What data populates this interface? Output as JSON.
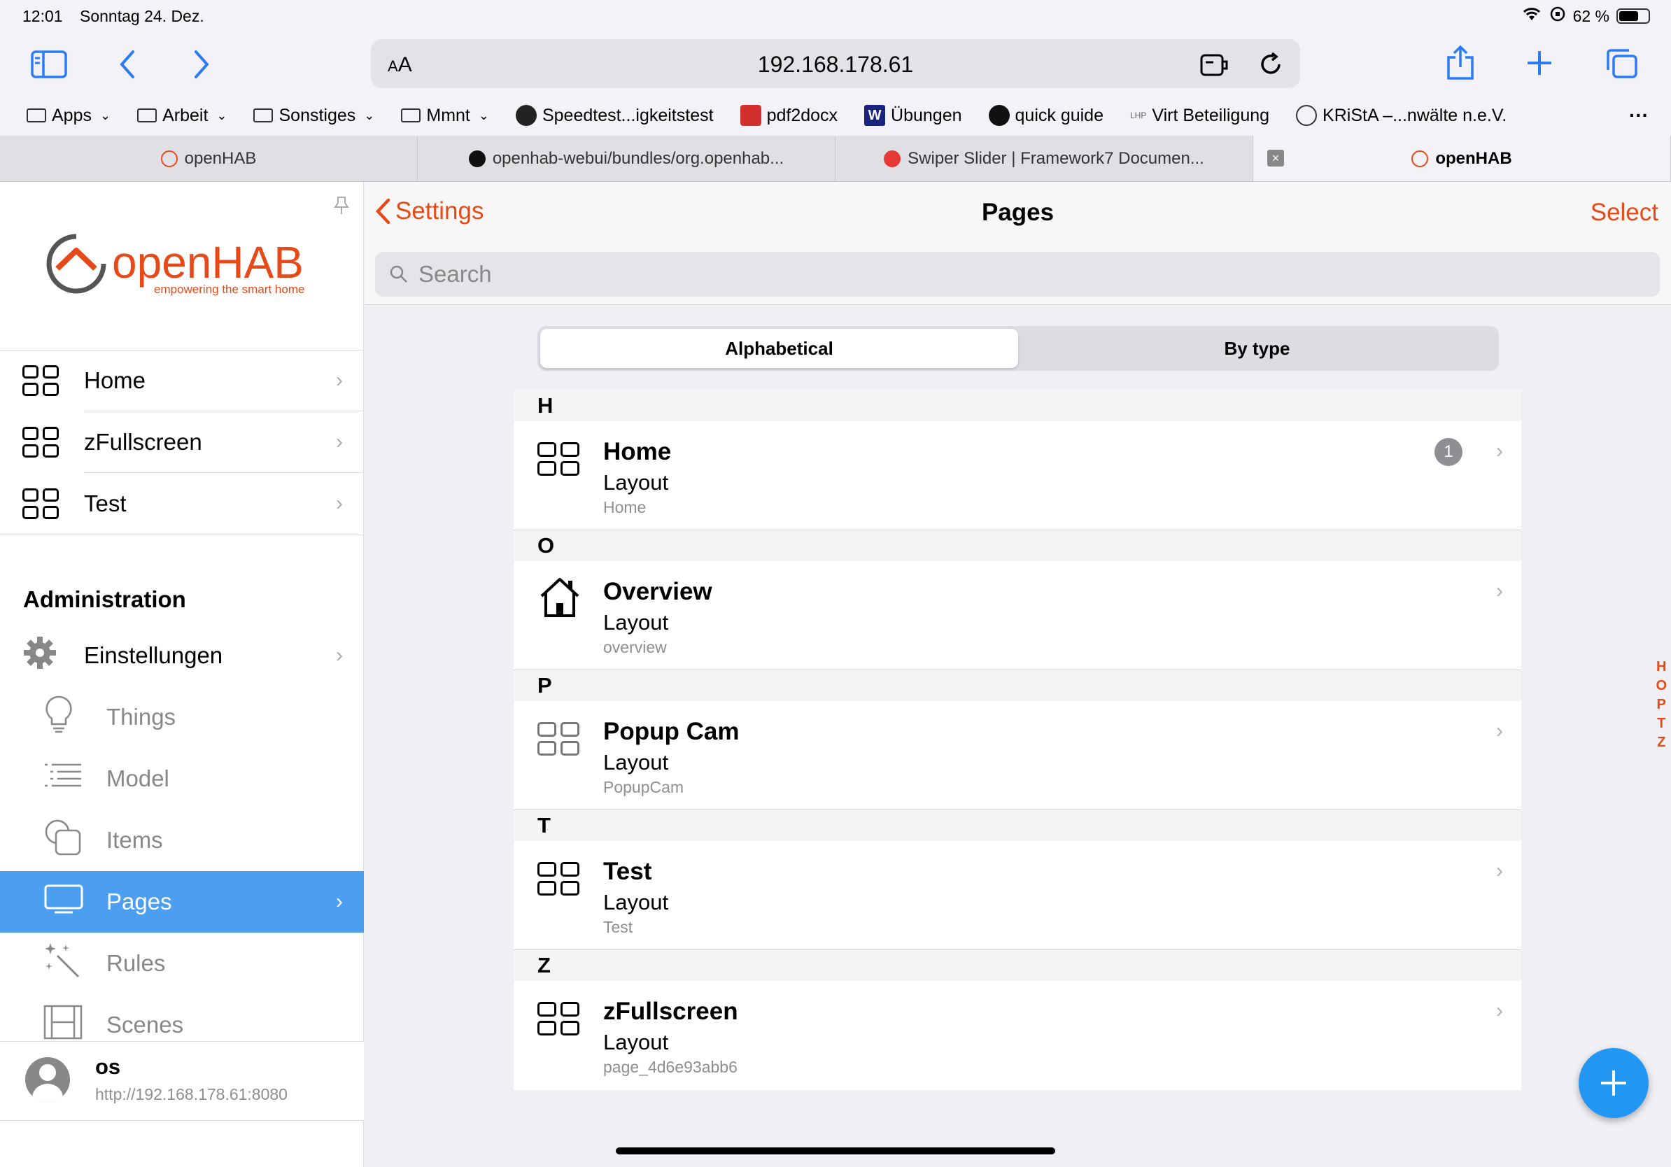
{
  "status": {
    "time": "12:01",
    "date": "Sonntag 24. Dez.",
    "battery": "62 %"
  },
  "browser": {
    "url": "192.168.178.61",
    "aa": "AA",
    "bookmarks": [
      {
        "label": "Apps",
        "folder": true
      },
      {
        "label": "Arbeit",
        "folder": true
      },
      {
        "label": "Sonstiges",
        "folder": true
      },
      {
        "label": "Mmnt",
        "folder": true
      },
      {
        "label": "Speedtest...igkeitstest",
        "folder": false
      },
      {
        "label": "pdf2docx",
        "folder": false
      },
      {
        "label": "Übungen",
        "folder": false
      },
      {
        "label": "quick guide",
        "folder": false
      },
      {
        "label": "Virt Beteiligung",
        "folder": false
      },
      {
        "label": "KRiStA –...nwälte n.e.V.",
        "folder": false
      }
    ],
    "tabs": [
      "openHAB",
      "openhab-webui/bundles/org.openhab...",
      "Swiper Slider | Framework7 Documen...",
      "openHAB"
    ]
  },
  "sidebar": {
    "logo_text": "openHAB",
    "logo_tagline": "empowering the smart home",
    "pages": [
      "Home",
      "zFullscreen",
      "Test"
    ],
    "admin_title": "Administration",
    "settings": "Einstellungen",
    "sub": [
      "Things",
      "Model",
      "Items",
      "Pages",
      "Rules",
      "Scenes"
    ],
    "user": {
      "name": "os",
      "url": "http://192.168.178.61:8080"
    }
  },
  "main": {
    "back": "Settings",
    "title": "Pages",
    "select": "Select",
    "search_placeholder": "Search",
    "segments": [
      "Alphabetical",
      "By type"
    ],
    "groups": [
      {
        "letter": "H",
        "items": [
          {
            "title": "Home",
            "type": "Layout",
            "uid": "Home",
            "badge": "1",
            "icon": "grid"
          }
        ]
      },
      {
        "letter": "O",
        "items": [
          {
            "title": "Overview",
            "type": "Layout",
            "uid": "overview",
            "icon": "home"
          }
        ]
      },
      {
        "letter": "P",
        "items": [
          {
            "title": "Popup Cam",
            "type": "Layout",
            "uid": "PopupCam",
            "icon": "grid-gray"
          }
        ]
      },
      {
        "letter": "T",
        "items": [
          {
            "title": "Test",
            "type": "Layout",
            "uid": "Test",
            "icon": "grid"
          }
        ]
      },
      {
        "letter": "Z",
        "items": [
          {
            "title": "zFullscreen",
            "type": "Layout",
            "uid": "page_4d6e93abb6",
            "icon": "grid"
          }
        ]
      }
    ],
    "index": [
      "H",
      "O",
      "P",
      "T",
      "Z"
    ],
    "fab": "+"
  }
}
